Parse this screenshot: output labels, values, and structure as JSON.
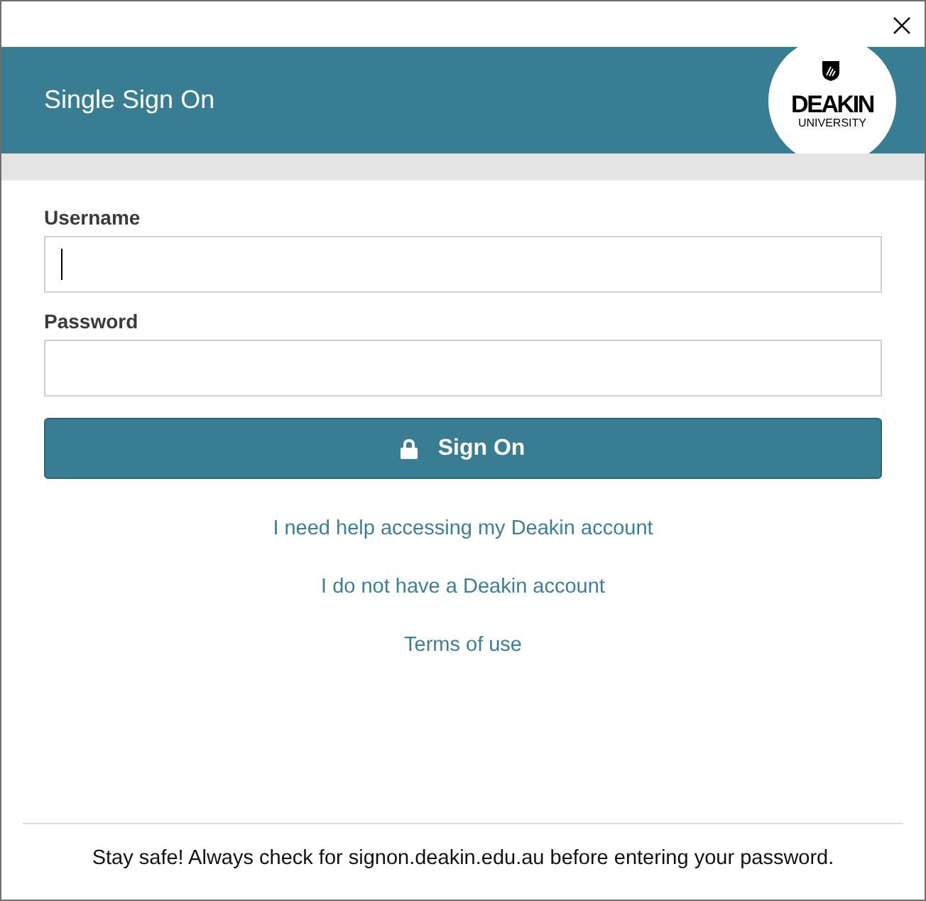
{
  "header": {
    "title": "Single Sign On",
    "logo": {
      "wordmark": "DEAKIN",
      "subtitle": "UNIVERSITY"
    }
  },
  "form": {
    "fields": [
      {
        "label": "Username",
        "focused": true
      },
      {
        "label": "Password",
        "focused": false
      }
    ],
    "submit": {
      "label": "Sign On"
    }
  },
  "links": [
    "I need help accessing my Deakin account",
    "I do not have a Deakin account",
    "Terms of use"
  ],
  "footer": {
    "notice": "Stay safe! Always check for signon.deakin.edu.au before entering your password."
  }
}
